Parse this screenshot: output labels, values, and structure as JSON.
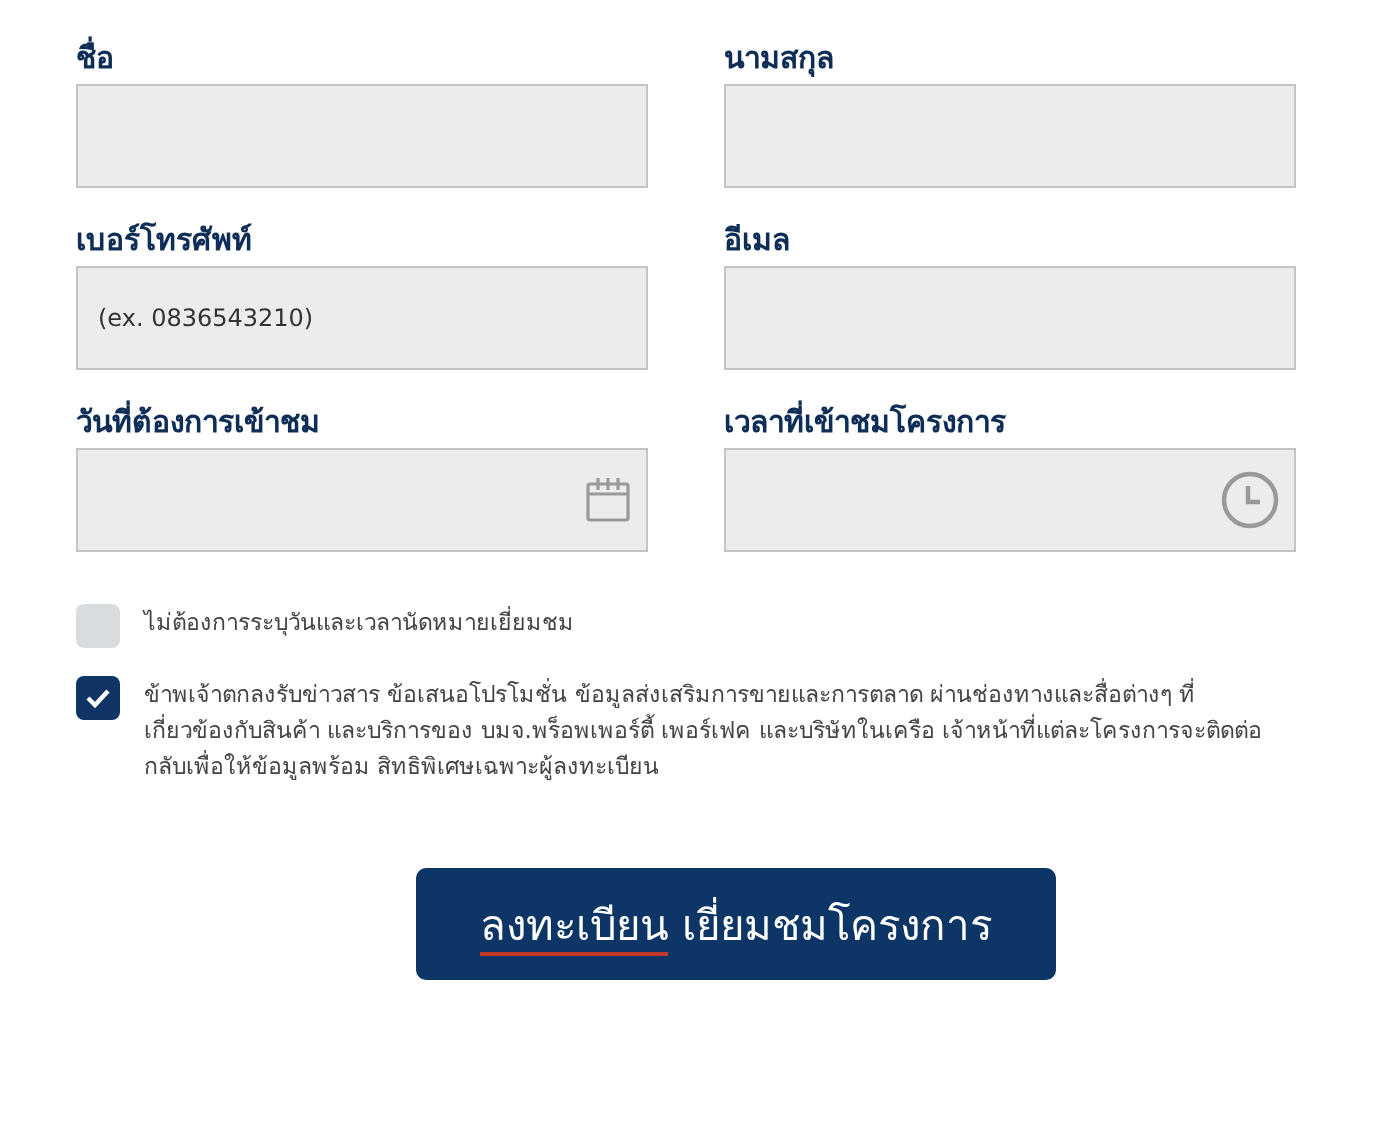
{
  "fields": [
    {
      "label": "ชื่อ",
      "kind": "text"
    },
    {
      "label": "นามสกุล",
      "kind": "text"
    },
    {
      "label": "เบอร์โทรศัพท์",
      "kind": "text",
      "placeholder": "(ex. 0836543210)"
    },
    {
      "label": "อีเมล",
      "kind": "text"
    },
    {
      "label": "วันที่ต้องการเข้าชม",
      "kind": "date"
    },
    {
      "label": "เวลาที่เข้าชมโครงการ",
      "kind": "time"
    }
  ],
  "checkboxes": [
    {
      "label": "ไม่ต้องการระบุวันและเวลานัดหมายเยี่ยมชม",
      "checked": false
    },
    {
      "label": "ข้าพเจ้าตกลงรับข่าวสาร ข้อเสนอโปรโมชั่น ข้อมูลส่งเสริมการขายและการตลาด ผ่านช่องทางและสื่อต่างๆ ที่เกี่ยวข้องกับสินค้า และบริการของ บมจ.พร็อพเพอร์ตี้ เพอร์เฟค และบริษัทในเครือ เจ้าหน้าที่แต่ละโครงการจะติดต่อกลับเพื่อให้ข้อมูลพร้อม สิทธิพิเศษเฉพาะผู้ลงทะเบียน",
      "checked": true
    }
  ],
  "submit": {
    "label_main": "ลงทะเบียน",
    "label_rest": "เยี่ยมชมโครงการ"
  }
}
